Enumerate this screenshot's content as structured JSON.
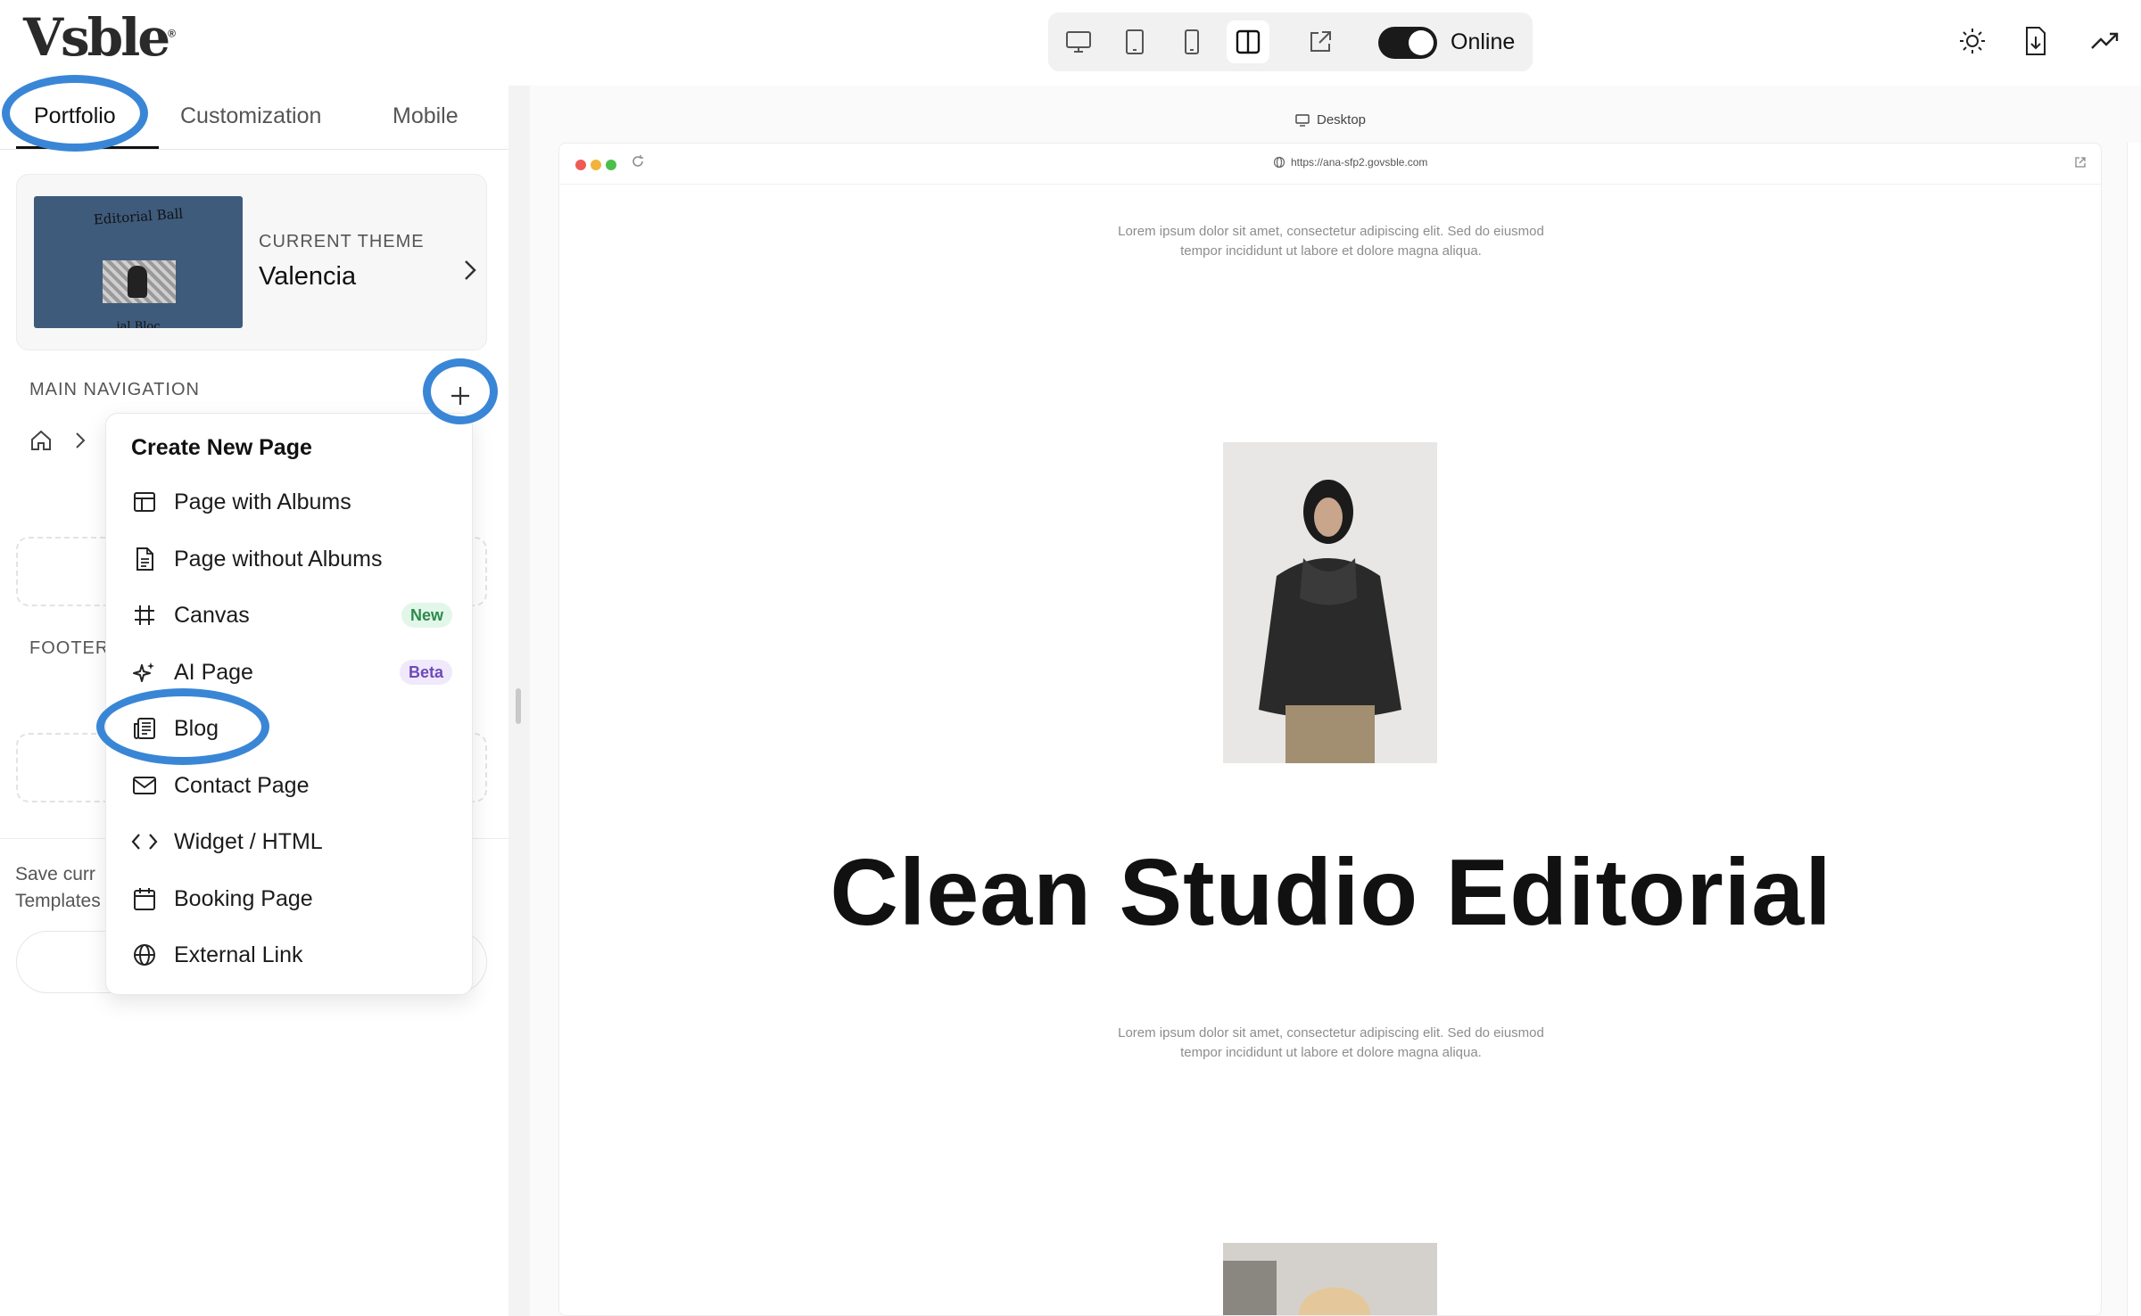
{
  "app": {
    "logo": "Vsble",
    "logo_mark": "®"
  },
  "tabs": [
    {
      "label": "Portfolio"
    },
    {
      "label": "Customization"
    },
    {
      "label": "Mobile"
    }
  ],
  "theme": {
    "label": "CURRENT THEME",
    "name": "Valencia",
    "thumb_title": "Editorial Ball",
    "thumb_bottom": "...ial Bloc..."
  },
  "main_navigation": {
    "label": "MAIN NAVIGATION"
  },
  "footer": {
    "label": "FOOTER"
  },
  "save_text": {
    "line1": "Save curr",
    "line2": "Templates"
  },
  "dropdown": {
    "title": "Create New Page",
    "items": [
      {
        "label": "Page with Albums",
        "icon": "layout-icon"
      },
      {
        "label": "Page without Albums",
        "icon": "document-icon"
      },
      {
        "label": "Canvas",
        "icon": "hash-icon",
        "badge": "New"
      },
      {
        "label": "AI Page",
        "icon": "sparkle-icon",
        "badge": "Beta"
      },
      {
        "label": "Blog",
        "icon": "newspaper-icon"
      },
      {
        "label": "Contact Page",
        "icon": "mail-icon"
      },
      {
        "label": "Widget / HTML",
        "icon": "code-icon"
      },
      {
        "label": "Booking Page",
        "icon": "calendar-icon"
      },
      {
        "label": "External Link",
        "icon": "globe-icon"
      }
    ]
  },
  "toolbar": {
    "status_label": "Online",
    "status_on": true,
    "active_view": "split"
  },
  "preview": {
    "device_label": "Desktop",
    "url": "https://ana-sfp2.govsble.com",
    "lorem_top_1": "Lorem ipsum dolor sit amet, consectetur adipiscing elit. Sed do eiusmod",
    "lorem_top_2": "tempor incididunt ut labore et dolore magna aliqua.",
    "headline": "Clean Studio Editorial",
    "lorem_bottom_1": "Lorem ipsum dolor sit amet, consectetur adipiscing elit. Sed do eiusmod",
    "lorem_bottom_2": "tempor incididunt ut labore et dolore magna aliqua."
  },
  "colors": {
    "annotation": "#3a86d6",
    "toggle_on": "#1a1a1a",
    "badge_new_bg": "#e3f6ea",
    "badge_new_text": "#2c8a4a",
    "badge_beta_bg": "#efe9fb",
    "badge_beta_text": "#6e4ab8"
  }
}
